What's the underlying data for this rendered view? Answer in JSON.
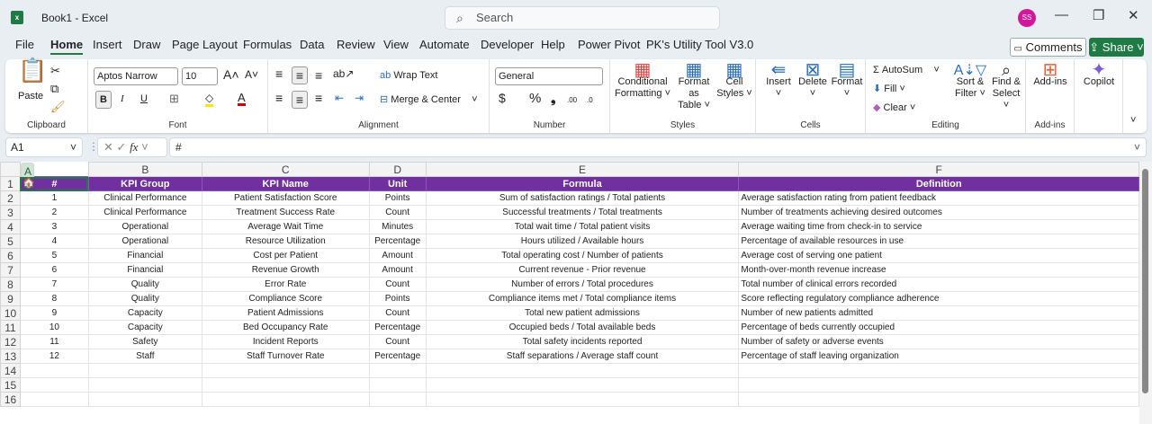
{
  "window": {
    "title": "Book1 - Excel",
    "search_placeholder": "Search",
    "avatar_initials": "SS",
    "minimize": "—",
    "restore": "❐",
    "close": "✕"
  },
  "tabs": [
    "File",
    "Home",
    "Insert",
    "Draw",
    "Page Layout",
    "Formulas",
    "Data",
    "Review",
    "View",
    "Automate",
    "Developer",
    "Help",
    "Power Pivot",
    "PK's Utility Tool V3.0"
  ],
  "active_tab": "Home",
  "actions": {
    "comments": "Comments",
    "share": "Share"
  },
  "ribbon": {
    "clipboard": {
      "label": "Clipboard",
      "paste": "Paste"
    },
    "font": {
      "label": "Font",
      "font_name": "Aptos Narrow",
      "font_size": "10",
      "bold": "B",
      "italic": "I",
      "underline": "U",
      "grow": "A˄",
      "shrink": "A˅"
    },
    "alignment": {
      "label": "Alignment",
      "wrap_text": "Wrap Text",
      "merge_center": "Merge & Center"
    },
    "number": {
      "label": "Number",
      "format": "General",
      "currency": "$",
      "percent": "%",
      "comma": "❟",
      "inc_decimal": ".00",
      "dec_decimal": ".0"
    },
    "styles": {
      "label": "Styles",
      "conditional": [
        "Conditional",
        "Formatting ˅"
      ],
      "format_table": [
        "Format as",
        "Table ˅"
      ],
      "cell_styles": [
        "Cell",
        "Styles ˅"
      ]
    },
    "cells": {
      "label": "Cells",
      "insert": "Insert",
      "delete": "Delete",
      "format": "Format"
    },
    "editing": {
      "label": "Editing",
      "autosum": "AutoSum",
      "fill": "Fill ˅",
      "clear": "Clear ˅",
      "sort": [
        "Sort &",
        "Filter ˅"
      ],
      "find": [
        "Find &",
        "Select ˅"
      ]
    },
    "addins": {
      "label": "Add-ins",
      "addins": "Add-ins"
    },
    "copilot": {
      "copilot": "Copilot"
    }
  },
  "formula_bar": {
    "name_box": "A1",
    "fx": "fx",
    "value": "#"
  },
  "sheet": {
    "columns": [
      "A",
      "B",
      "C",
      "D",
      "E",
      "F"
    ],
    "header": [
      "#",
      "KPI Group",
      "KPI Name",
      "Unit",
      "Formula",
      "Definition"
    ],
    "rows": [
      [
        "1",
        "Clinical Performance",
        "Patient Satisfaction Score",
        "Points",
        "Sum of satisfaction ratings / Total patients",
        "Average satisfaction rating from patient feedback"
      ],
      [
        "2",
        "Clinical Performance",
        "Treatment Success Rate",
        "Count",
        "Successful treatments / Total treatments",
        "Number of treatments achieving desired outcomes"
      ],
      [
        "3",
        "Operational",
        "Average Wait Time",
        "Minutes",
        "Total wait time / Total patient visits",
        "Average waiting time from check-in to service"
      ],
      [
        "4",
        "Operational",
        "Resource Utilization",
        "Percentage",
        "Hours utilized / Available hours",
        "Percentage of available resources in use"
      ],
      [
        "5",
        "Financial",
        "Cost per Patient",
        "Amount",
        "Total operating cost / Number of patients",
        "Average cost of serving one patient"
      ],
      [
        "6",
        "Financial",
        "Revenue Growth",
        "Amount",
        "Current revenue - Prior revenue",
        "Month-over-month revenue increase"
      ],
      [
        "7",
        "Quality",
        "Error Rate",
        "Count",
        "Number of errors / Total procedures",
        "Total number of clinical errors recorded"
      ],
      [
        "8",
        "Quality",
        "Compliance Score",
        "Points",
        "Compliance items met / Total compliance items",
        "Score reflecting regulatory compliance adherence"
      ],
      [
        "9",
        "Capacity",
        "Patient Admissions",
        "Count",
        "Total new patient admissions",
        "Number of new patients admitted"
      ],
      [
        "10",
        "Capacity",
        "Bed Occupancy Rate",
        "Percentage",
        "Occupied beds / Total available beds",
        "Percentage of beds currently occupied"
      ],
      [
        "11",
        "Safety",
        "Incident Reports",
        "Count",
        "Total safety incidents reported",
        "Number of safety or adverse events"
      ],
      [
        "12",
        "Staff",
        "Staff Turnover Rate",
        "Percentage",
        "Staff separations / Average staff count",
        "Percentage of staff leaving organization"
      ]
    ],
    "row_numbers": [
      "1",
      "2",
      "3",
      "4",
      "5",
      "6",
      "7",
      "8",
      "9",
      "10",
      "11",
      "12",
      "13",
      "14",
      "15",
      "16"
    ],
    "header_color": "#7030A0"
  }
}
